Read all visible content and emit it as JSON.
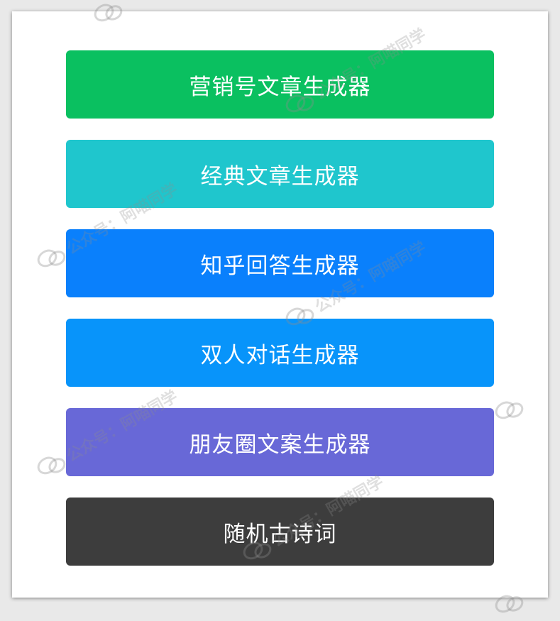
{
  "buttons": [
    {
      "label": "营销号文章生成器",
      "color": "#0ac060"
    },
    {
      "label": "经典文章生成器",
      "color": "#1fc6cd"
    },
    {
      "label": "知乎回答生成器",
      "color": "#0a80fc"
    },
    {
      "label": "双人对话生成器",
      "color": "#0894fa"
    },
    {
      "label": "朋友圈文案生成器",
      "color": "#6868d7"
    },
    {
      "label": "随机古诗词",
      "color": "#3d3d3d"
    }
  ],
  "watermark": {
    "text": "公众号：阿喵同学",
    "icon": "wechat-icon"
  }
}
